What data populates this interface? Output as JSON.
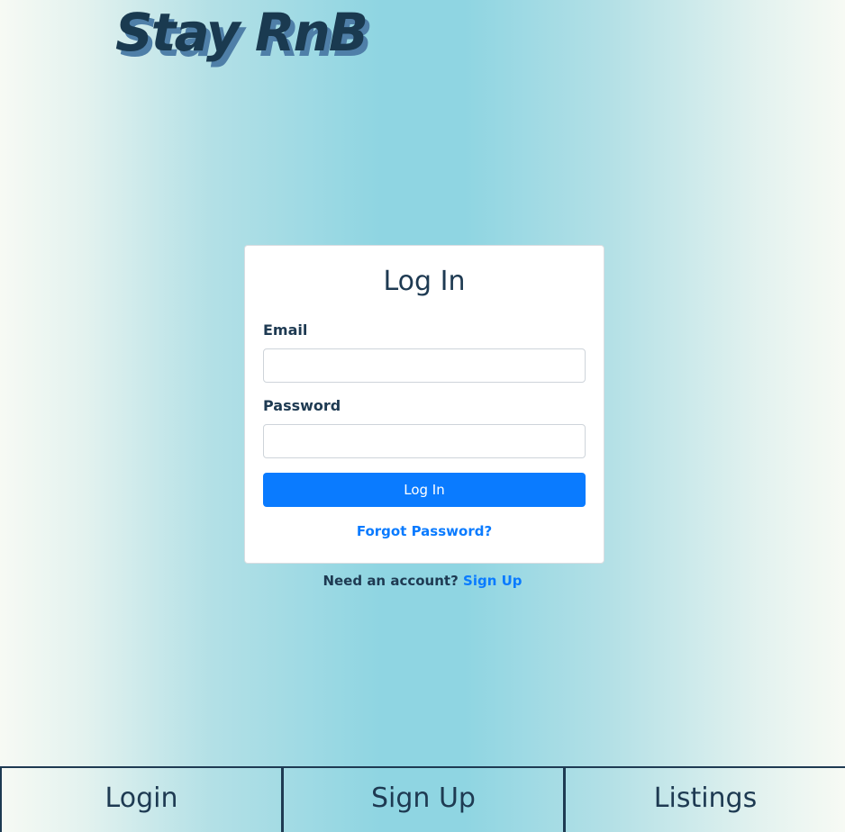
{
  "brand": {
    "logo_text": "Stay RnB"
  },
  "login_form": {
    "title": "Log In",
    "email_label": "Email",
    "email_value": "",
    "password_label": "Password",
    "password_value": "",
    "submit_label": "Log In",
    "forgot_label": "Forgot Password?"
  },
  "signup_prompt": {
    "text": "Need an account?",
    "link_label": "Sign Up"
  },
  "bottom_nav": {
    "items": [
      {
        "label": "Login"
      },
      {
        "label": "Sign Up"
      },
      {
        "label": "Listings"
      }
    ]
  },
  "colors": {
    "primary": "#0a7bff",
    "text": "#1e3a52",
    "background_center": "#8fd5e2",
    "background_edge": "#f7faf4"
  }
}
